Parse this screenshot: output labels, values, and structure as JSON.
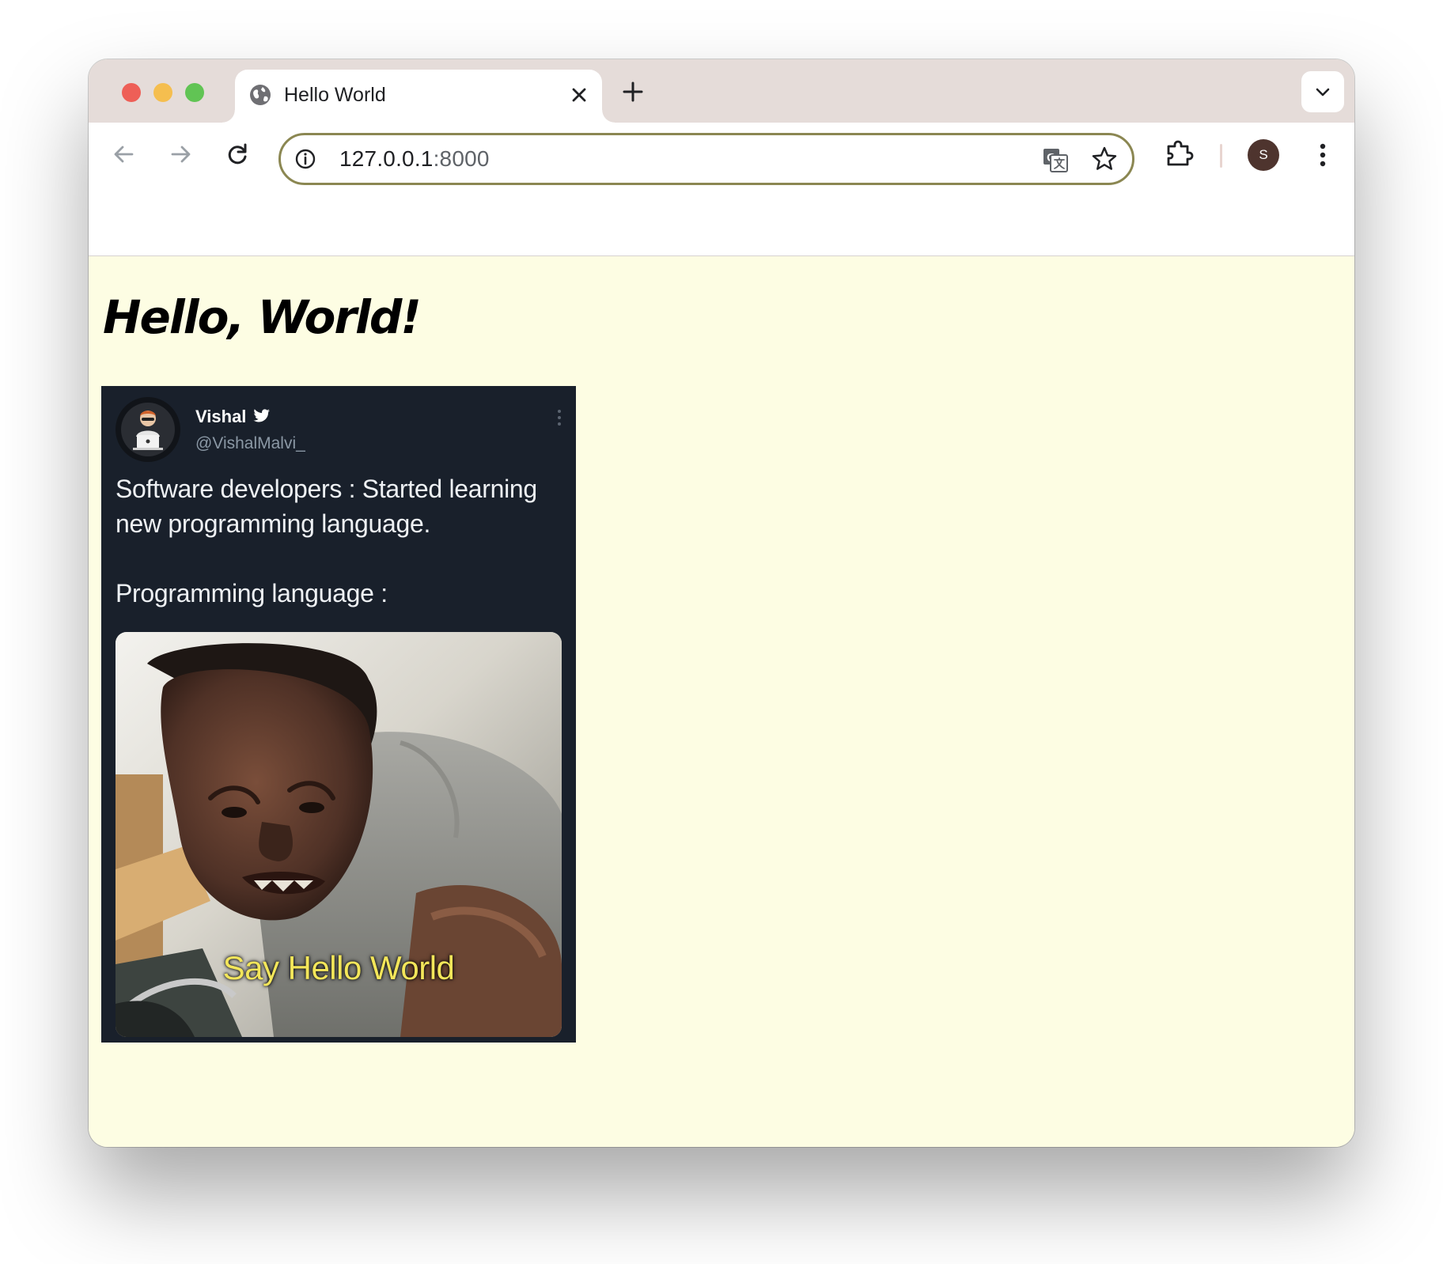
{
  "browser": {
    "tab": {
      "title": "Hello World",
      "favicon": "globe-icon"
    },
    "address_bar": {
      "host": "127.0.0.1",
      "port": ":8000"
    },
    "profile": {
      "initial": "S",
      "color": "#4e342e"
    },
    "icons": {
      "back": "arrow-left-icon",
      "forward": "arrow-right-icon",
      "reload": "reload-icon",
      "info": "info-icon",
      "translate": "translate-icon",
      "bookmark": "star-icon",
      "extensions": "puzzle-piece-icon",
      "menu": "kebab-menu-icon",
      "new_tab": "plus-icon",
      "tab_search": "chevron-down-icon",
      "close_tab": "close-icon"
    },
    "accent_color": "#8b8752"
  },
  "page": {
    "background": "#fdfde3",
    "heading": "Hello, World!",
    "meme": {
      "author_name": "Vishal",
      "author_handle": "@VishalMalvi_",
      "verified_icon": "twitter-bird-icon",
      "more_icon": "kebab-menu-icon",
      "text_line_1": "Software developers : Started learning new programming language.",
      "text_line_2": "Programming language :",
      "photo_caption": "Say Hello World",
      "background": "#19202b"
    }
  }
}
